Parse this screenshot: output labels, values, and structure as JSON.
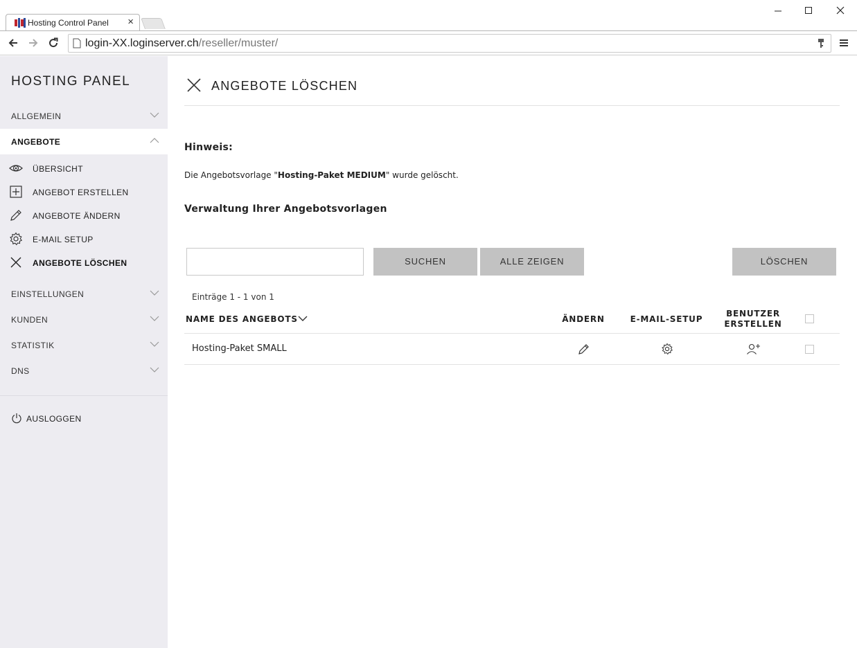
{
  "browser": {
    "tab_title": "Hosting Control Panel",
    "url_host": "login-XX.loginserver.ch",
    "url_path": "/reseller/muster/"
  },
  "sidebar": {
    "brand": "HOSTING PANEL",
    "sections": [
      {
        "label": "ALLGEMEIN",
        "expanded": false
      },
      {
        "label": "ANGEBOTE",
        "expanded": true
      },
      {
        "label": "EINSTELLUNGEN",
        "expanded": false
      },
      {
        "label": "KUNDEN",
        "expanded": false
      },
      {
        "label": "STATISTIK",
        "expanded": false
      },
      {
        "label": "DNS",
        "expanded": false
      }
    ],
    "angebote_items": [
      {
        "label": "ÜBERSICHT",
        "icon": "eye-icon"
      },
      {
        "label": "ANGEBOT ERSTELLEN",
        "icon": "plus-box-icon"
      },
      {
        "label": "ANGEBOTE ÄNDERN",
        "icon": "pencil-icon"
      },
      {
        "label": "E-MAIL SETUP",
        "icon": "gear-icon"
      },
      {
        "label": "ANGEBOTE LÖSCHEN",
        "icon": "close-icon",
        "current": true
      }
    ],
    "logout": "AUSLOGGEN"
  },
  "main": {
    "title": "ANGEBOTE LÖSCHEN",
    "hint_title": "Hinweis:",
    "hint_pre": "Die Angebotsvorlage \"",
    "hint_bold": "Hosting-Paket MEDIUM",
    "hint_post": "\" wurde gelöscht.",
    "section_title": "Verwaltung Ihrer Angebotsvorlagen",
    "search": {
      "value": "",
      "placeholder": ""
    },
    "buttons": {
      "search": "SUCHEN",
      "show_all": "ALLE ZEIGEN",
      "delete": "LÖSCHEN"
    },
    "count": "Einträge 1 - 1 von 1",
    "table": {
      "headers": {
        "name": "NAME DES ANGEBOTS",
        "edit": "ÄNDERN",
        "mail": "E-MAIL-SETUP",
        "user_line1": "BENUTZER",
        "user_line2": "ERSTELLEN"
      },
      "rows": [
        {
          "name": "Hosting-Paket SMALL",
          "checked": false
        }
      ]
    }
  },
  "colors": {
    "sidebar_bg": "#edecf1",
    "button_bg": "#c2c2c2",
    "favicon_red": "#c0262d",
    "favicon_blue": "#2b4a9c"
  }
}
